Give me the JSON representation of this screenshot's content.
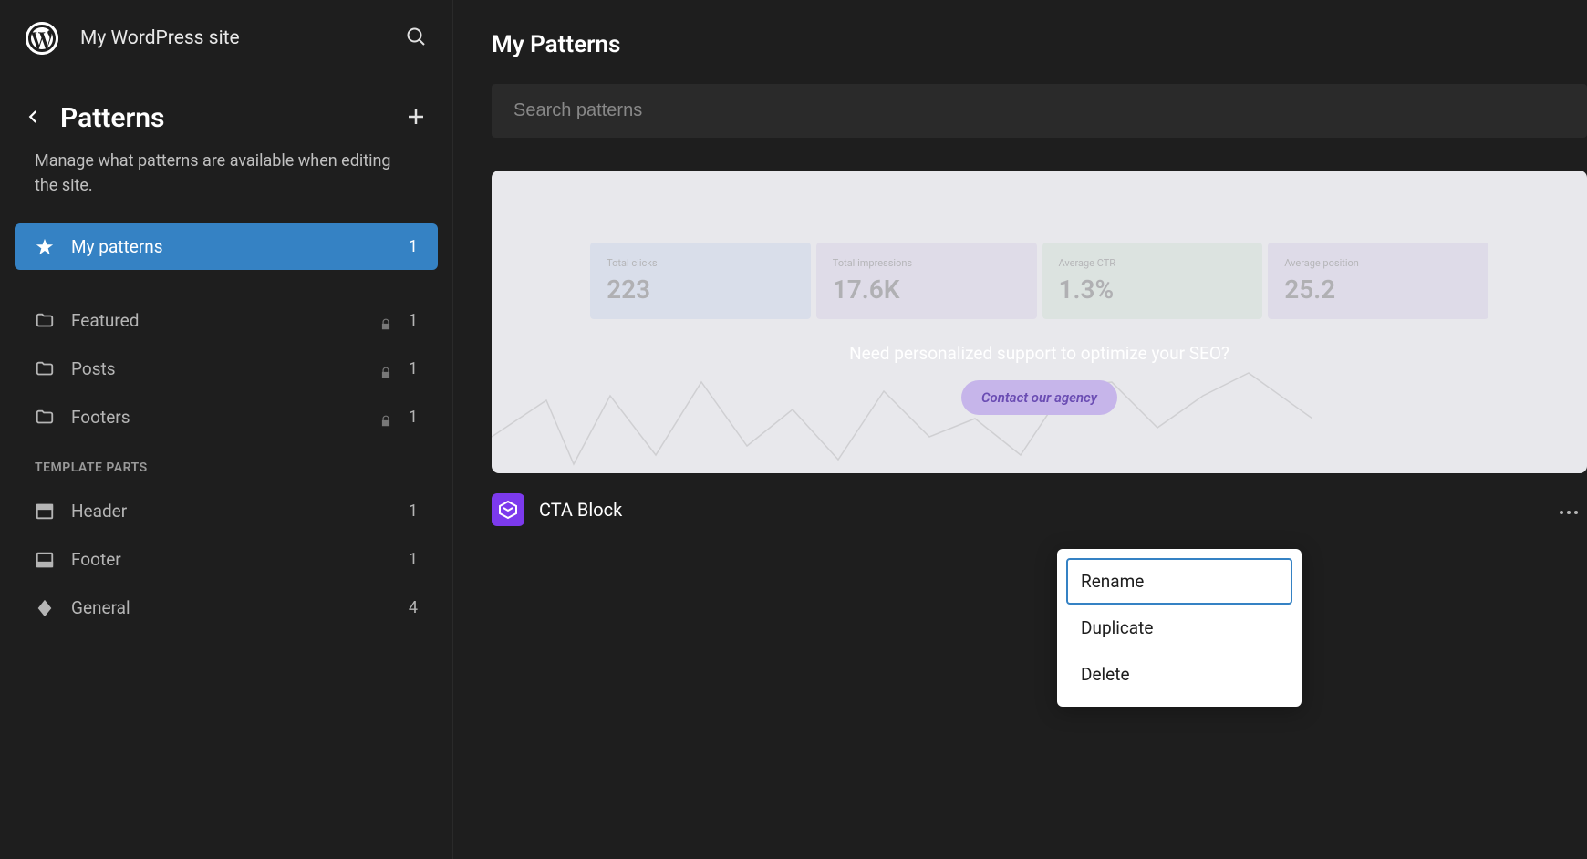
{
  "site": {
    "title": "My WordPress site"
  },
  "sidebar": {
    "page_title": "Patterns",
    "description": "Manage what patterns are available when editing the site.",
    "items": [
      {
        "label": "My patterns",
        "count": "1",
        "icon": "star",
        "active": true,
        "locked": false
      },
      {
        "label": "Featured",
        "count": "1",
        "icon": "folder",
        "active": false,
        "locked": true
      },
      {
        "label": "Posts",
        "count": "1",
        "icon": "folder",
        "active": false,
        "locked": true
      },
      {
        "label": "Footers",
        "count": "1",
        "icon": "folder",
        "active": false,
        "locked": true
      }
    ],
    "template_parts_header": "TEMPLATE PARTS",
    "template_parts": [
      {
        "label": "Header",
        "count": "1",
        "icon": "header"
      },
      {
        "label": "Footer",
        "count": "1",
        "icon": "footer"
      },
      {
        "label": "General",
        "count": "4",
        "icon": "diamond"
      }
    ]
  },
  "main": {
    "title": "My Patterns",
    "search_placeholder": "Search patterns",
    "pattern": {
      "name": "CTA Block",
      "preview": {
        "heading": "Need personalized support to optimize your SEO?",
        "button": "Contact our agency",
        "stats": [
          {
            "label": "Total clicks",
            "value": "223"
          },
          {
            "label": "Total impressions",
            "value": "17.6K"
          },
          {
            "label": "Average CTR",
            "value": "1.3%"
          },
          {
            "label": "Average position",
            "value": "25.2"
          }
        ]
      }
    }
  },
  "context_menu": {
    "items": [
      {
        "label": "Rename",
        "focused": true
      },
      {
        "label": "Duplicate",
        "focused": false
      },
      {
        "label": "Delete",
        "focused": false
      }
    ]
  }
}
